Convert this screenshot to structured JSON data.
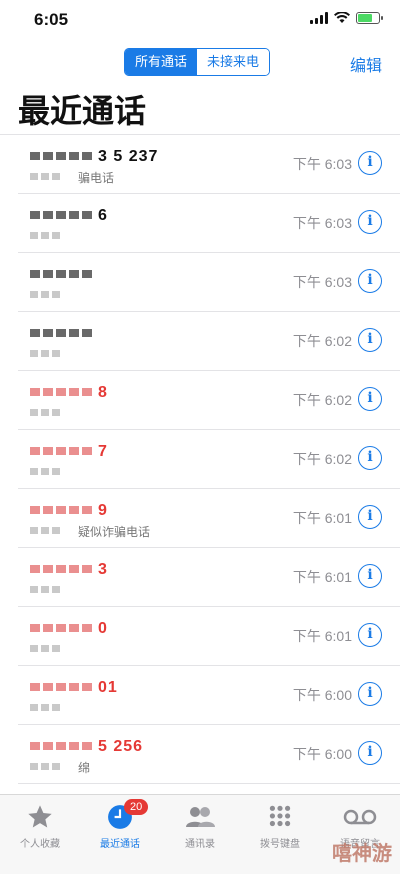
{
  "status": {
    "time": "6:05"
  },
  "segments": [
    {
      "label": "所有通话",
      "active": true
    },
    {
      "label": "未接来电",
      "active": false
    }
  ],
  "nav": {
    "edit": "编辑",
    "title": "最近通话"
  },
  "calls": [
    {
      "number": "3 5 237",
      "sub": "骗电话",
      "time": "下午 6:03",
      "missed": false
    },
    {
      "number": "6",
      "sub": "",
      "time": "下午 6:03",
      "missed": false
    },
    {
      "number": "",
      "sub": "",
      "time": "下午 6:03",
      "missed": false
    },
    {
      "number": "",
      "sub": "",
      "time": "下午 6:02",
      "missed": false
    },
    {
      "number": "8",
      "sub": "",
      "time": "下午 6:02",
      "missed": true
    },
    {
      "number": "7",
      "sub": "",
      "time": "下午 6:02",
      "missed": true
    },
    {
      "number": "9",
      "sub": "疑似诈骗电话",
      "time": "下午 6:01",
      "missed": true
    },
    {
      "number": "3",
      "sub": "",
      "time": "下午 6:01",
      "missed": true
    },
    {
      "number": "0",
      "sub": "",
      "time": "下午 6:01",
      "missed": true
    },
    {
      "number": "01",
      "sub": "",
      "time": "下午 6:00",
      "missed": true
    },
    {
      "number": "5 256",
      "sub": "绵",
      "time": "下午 6:00",
      "missed": true
    }
  ],
  "tabs": [
    {
      "label": "个人收藏",
      "icon": "star-icon",
      "active": false
    },
    {
      "label": "最近通话",
      "icon": "clock-icon",
      "active": true,
      "badge": "20"
    },
    {
      "label": "通讯录",
      "icon": "contacts-icon",
      "active": false
    },
    {
      "label": "拨号键盘",
      "icon": "keypad-icon",
      "active": false
    },
    {
      "label": "语音留言",
      "icon": "voicemail-icon",
      "active": false
    }
  ],
  "watermark": "嘻神游",
  "colors": {
    "accent": "#1a7be6",
    "missed": "#e53935",
    "badge": "#e53935"
  }
}
